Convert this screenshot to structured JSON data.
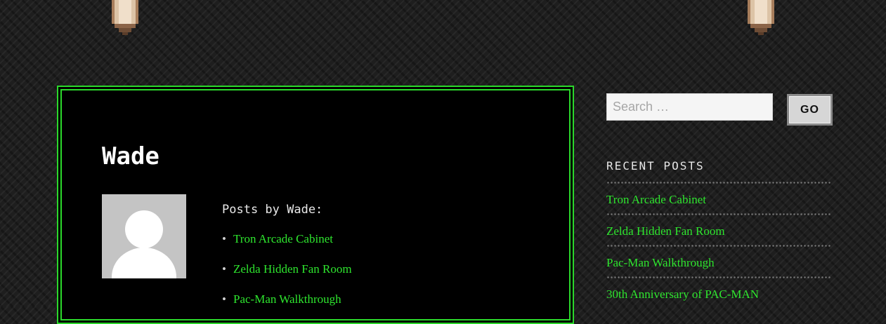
{
  "author": {
    "name": "Wade",
    "posts_heading": "Posts by Wade:",
    "posts": [
      "Tron Arcade Cabinet",
      "Zelda Hidden Fan Room",
      "Pac-Man Walkthrough"
    ]
  },
  "sidebar": {
    "search": {
      "placeholder": "Search …",
      "button_label": "GO"
    },
    "recent_posts": {
      "heading": "RECENT POSTS",
      "items": [
        "Tron Arcade Cabinet",
        "Zelda Hidden Fan Room",
        "Pac-Man Walkthrough",
        "30th Anniversary of PAC-MAN"
      ]
    }
  },
  "colors": {
    "accent_green": "#2ee52e",
    "panel_border": "#2bd82b",
    "background": "#1e1e1e"
  },
  "icons": {
    "hanger": "pixel-bracket-icon",
    "avatar": "default-avatar-icon"
  }
}
